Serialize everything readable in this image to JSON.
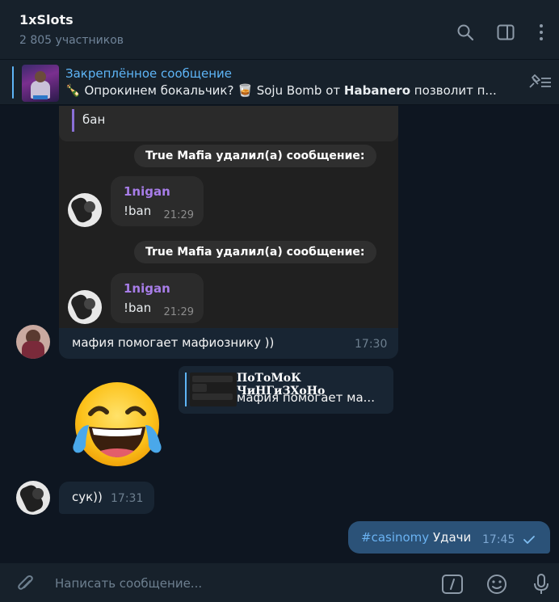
{
  "header": {
    "title": "1xSlots",
    "members": "2 805 участников"
  },
  "pinned": {
    "title": "Закреплённое сообщение",
    "emoji1": "🍾",
    "text_a": "Опрокинем бокальчик?",
    "emoji2": "🥃",
    "text_b": "Soju Bomb от",
    "text_bold": "Habanero",
    "text_c": "позволит п..."
  },
  "screenshot": {
    "quote_text": "бан",
    "service1": "True Mafia удалил(а) сообщение:",
    "service2": "True Mafia удалил(а) сообщение:",
    "msg1": {
      "name": "1nigan",
      "text": "!ban",
      "time": "21:29"
    },
    "msg2": {
      "name": "1nigan",
      "text": "!ban",
      "time": "21:29"
    }
  },
  "messages": [
    {
      "text": "мафия  помогает мафиознику ))",
      "time": "17:30"
    },
    {
      "reply_name": "ПоТоМоК ЧиНГиЗХоНо",
      "reply_text": "мафия  помогает ма..."
    },
    {
      "emoji": "😂"
    },
    {
      "text": "сук))",
      "time": "17:31"
    }
  ],
  "outgoing": {
    "hashtag": "#casinomy",
    "text": "Удачи",
    "time": "17:45"
  },
  "composer": {
    "placeholder": "Написать сообщение..."
  },
  "colors": {
    "accent": "#5eb5f7",
    "outgoing_bubble": "#2b5278",
    "incoming_bubble": "#182533"
  }
}
